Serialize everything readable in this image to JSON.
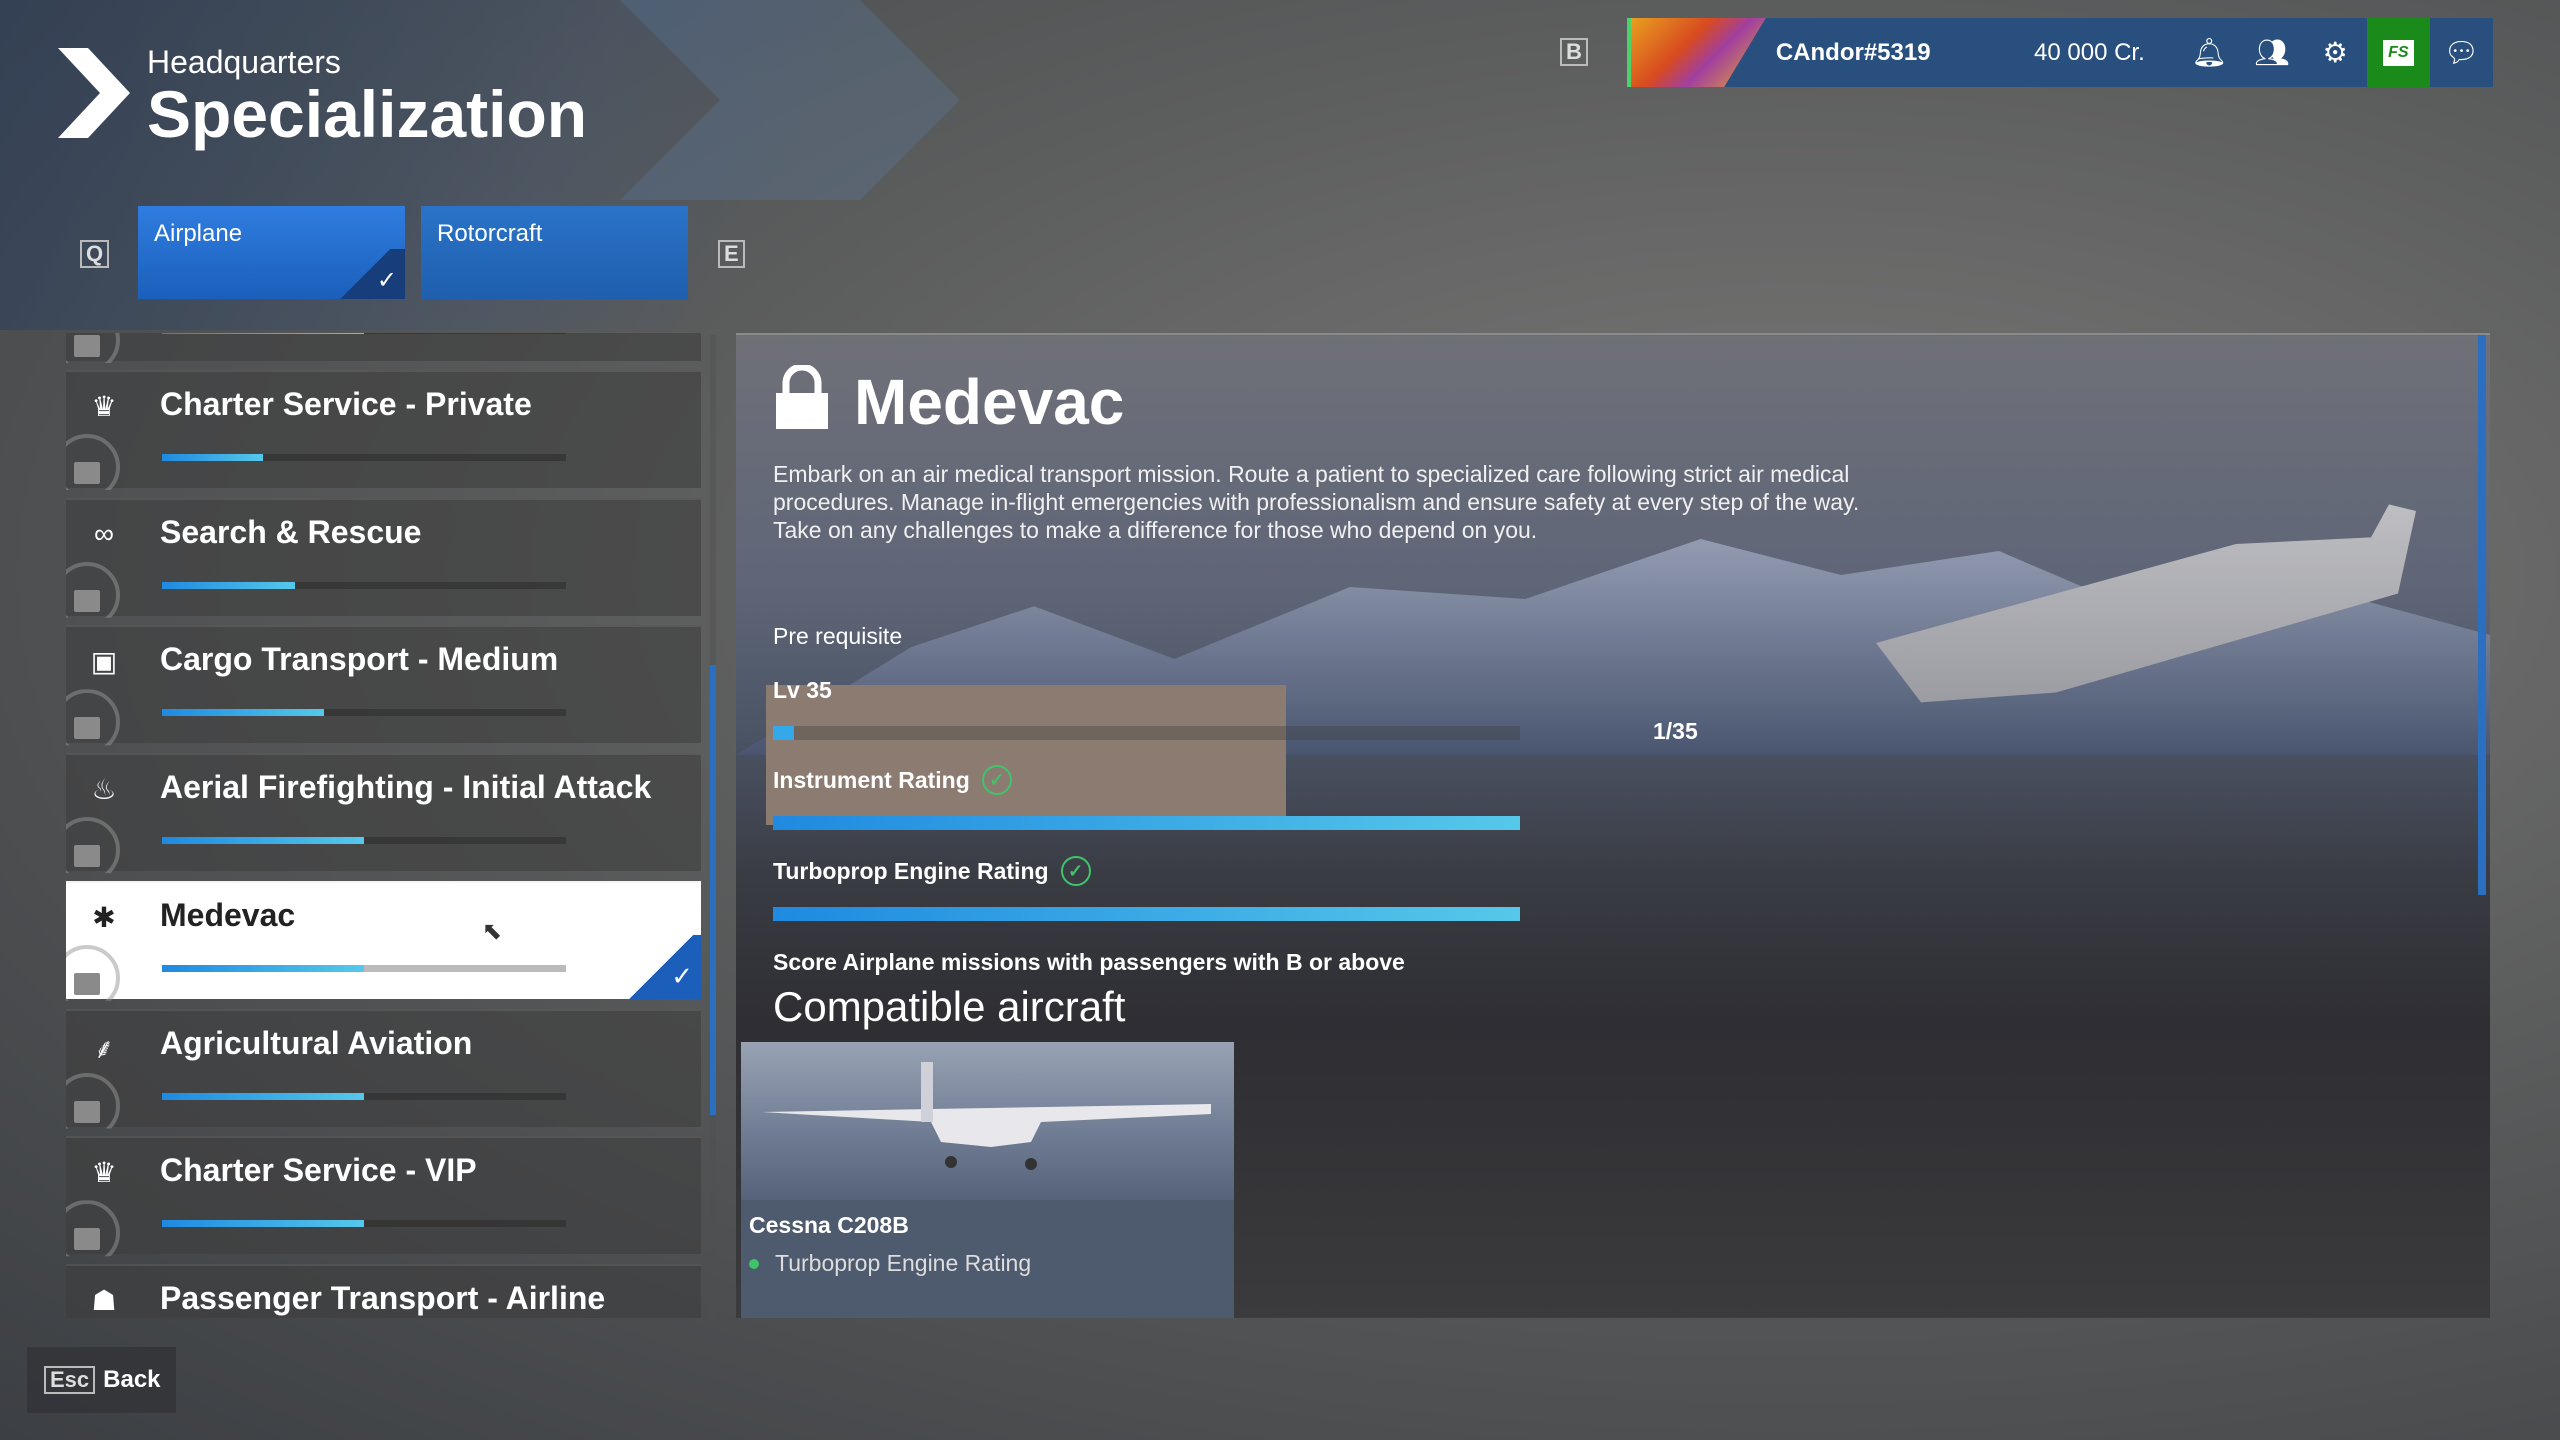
{
  "header": {
    "breadcrumb": "Headquarters",
    "title": "Specialization"
  },
  "topbar": {
    "key_hint": "B",
    "username": "CAndor#5319",
    "credits": "40 000 Cr.",
    "icons": [
      "bell-icon",
      "friends-icon",
      "gear-icon",
      "marketplace-icon",
      "chat-icon"
    ],
    "marketplace_label": "FS"
  },
  "tabs": {
    "prev_key": "Q",
    "next_key": "E",
    "items": [
      {
        "label": "Airplane",
        "selected": true
      },
      {
        "label": "Rotorcraft",
        "selected": false
      }
    ]
  },
  "specializations": [
    {
      "label": "",
      "icon": "lock-icon",
      "progress": 0.5,
      "locked": true,
      "partial": true
    },
    {
      "label": "Charter Service - Private",
      "icon": "vip-crown-icon",
      "glyph": "♛",
      "progress": 0.25,
      "locked": true
    },
    {
      "label": "Search & Rescue",
      "icon": "binoculars-icon",
      "glyph": "∞",
      "progress": 0.33,
      "locked": true
    },
    {
      "label": "Cargo Transport - Medium",
      "icon": "package-icon",
      "glyph": "▣",
      "progress": 0.4,
      "locked": true
    },
    {
      "label": "Aerial Firefighting - Initial Attack",
      "icon": "flame-icon",
      "glyph": "♨",
      "progress": 0.5,
      "locked": true
    },
    {
      "label": "Medevac",
      "icon": "medical-star-icon",
      "glyph": "✱",
      "progress": 0.5,
      "locked": true,
      "selected": true
    },
    {
      "label": "Agricultural Aviation",
      "icon": "wheat-icon",
      "glyph": "⸙",
      "progress": 0.5,
      "locked": true
    },
    {
      "label": "Charter Service - VIP",
      "icon": "vip-crown-icon",
      "glyph": "♛",
      "progress": 0.5,
      "locked": true
    },
    {
      "label": "Passenger Transport - Airline",
      "icon": "pilot-cap-icon",
      "glyph": "☗",
      "progress": null,
      "locked": true
    }
  ],
  "detail": {
    "title": "Medevac",
    "description": "Embark on an air medical transport mission. Route a patient to specialized care following strict air medical procedures. Manage in-flight emergencies with professionalism and ensure safety at every step of the way. Take on any challenges to make a difference for those who depend on you.",
    "prereq_label": "Pre requisite",
    "level": {
      "label": "Lv 35",
      "progress_text": "1/35",
      "progress": 0.0286
    },
    "requirements": [
      {
        "label": "Instrument Rating",
        "done": true,
        "progress": 1.0
      },
      {
        "label": "Turboprop Engine Rating",
        "done": true,
        "progress": 1.0
      }
    ],
    "score_requirement": "Score Airplane missions with passengers with B or above",
    "compatible_heading": "Compatible aircraft",
    "aircraft": [
      {
        "name": "Cessna C208B",
        "requirement": "Turboprop Engine Rating",
        "met": true
      }
    ]
  },
  "footer": {
    "back_key": "Esc",
    "back_label": "Back"
  },
  "colors": {
    "accent": "#1f8ae0",
    "topbar": "#284f7d",
    "success": "#3fc46a",
    "marketplace": "#1a8a1a"
  }
}
